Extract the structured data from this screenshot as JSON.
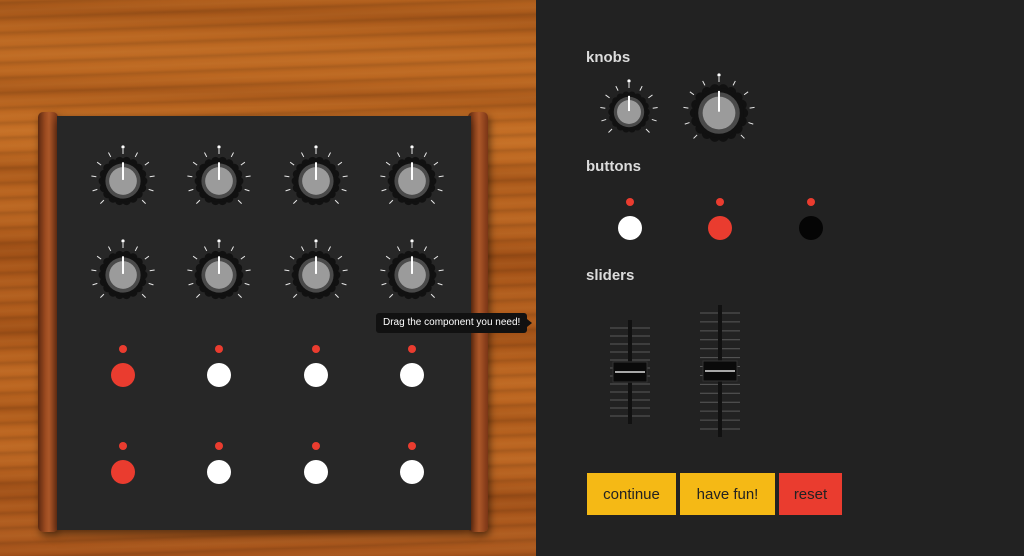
{
  "workspace": {
    "panel_rows": [
      {
        "type": "knob",
        "count": 4
      },
      {
        "type": "knob",
        "count": 4
      },
      {
        "type": "button",
        "colors": [
          "red",
          "white",
          "white",
          "white"
        ]
      },
      {
        "type": "button",
        "colors": [
          "red",
          "white",
          "white",
          "white"
        ]
      }
    ],
    "tooltip": "Drag the component you need!"
  },
  "palette": {
    "knobs_title": "knobs",
    "knob_sizes": [
      "small",
      "large"
    ],
    "buttons_title": "buttons",
    "button_colors": [
      "white",
      "red",
      "black"
    ],
    "sliders_title": "sliders",
    "slider_sizes": [
      "short",
      "tall"
    ]
  },
  "actions": {
    "continue_label": "continue",
    "havefun_label": "have fun!",
    "reset_label": "reset"
  },
  "colors": {
    "accent_yellow": "#f5b915",
    "accent_red": "#ea3c2f",
    "panel": "#272727",
    "background": "#222222",
    "knob_cap": "#9b9b9b"
  }
}
